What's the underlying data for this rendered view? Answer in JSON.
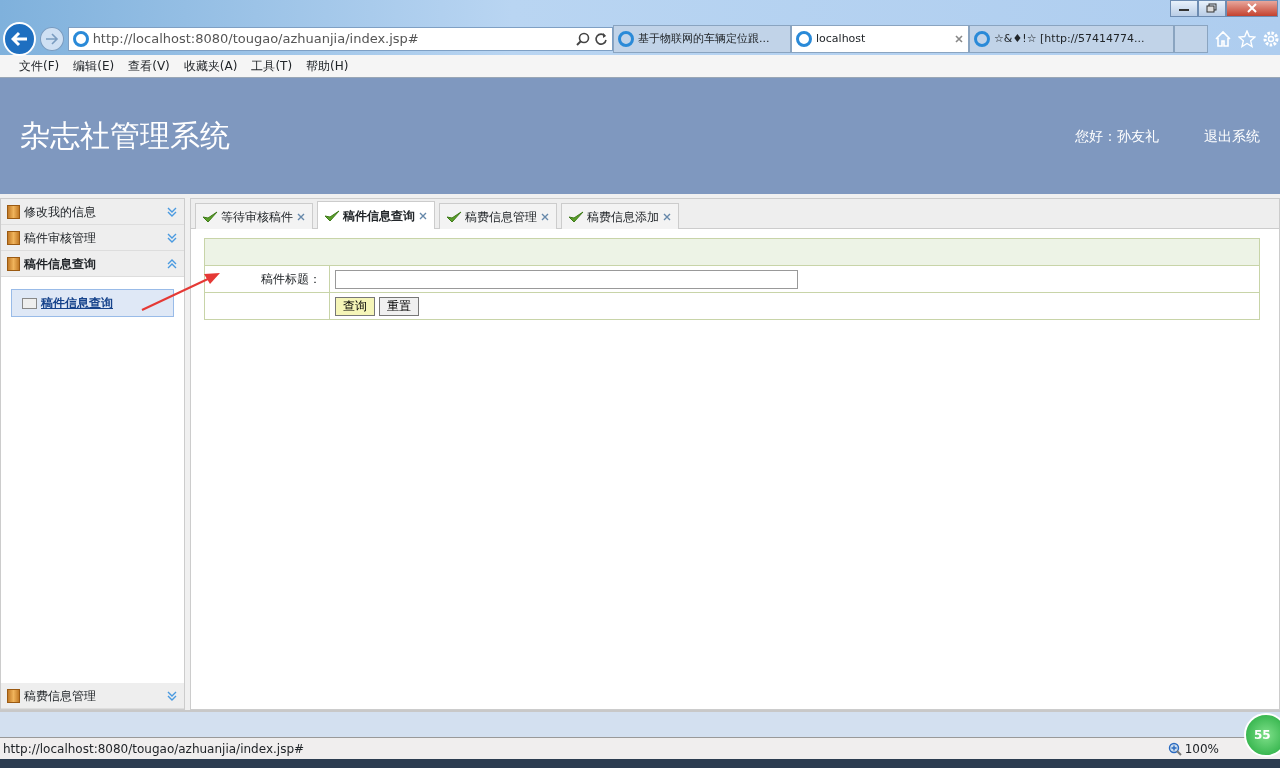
{
  "browser": {
    "address": "http://localhost:8080/tougao/azhuanjia/index.jsp#",
    "tabs": [
      {
        "title": "基于物联网的车辆定位跟...",
        "selected": false
      },
      {
        "title": "localhost",
        "selected": true
      },
      {
        "title": "☆&♦!☆ [http://57414774...",
        "selected": false
      }
    ],
    "menu": [
      "文件(F)",
      "编辑(E)",
      "查看(V)",
      "收藏夹(A)",
      "工具(T)",
      "帮助(H)"
    ]
  },
  "header": {
    "title": "杂志社管理系统",
    "greeting": "您好：孙友礼",
    "logout": "退出系统"
  },
  "sidebar": {
    "sections": [
      {
        "label": "修改我的信息",
        "expanded": false
      },
      {
        "label": "稿件审核管理",
        "expanded": false
      },
      {
        "label": "稿件信息查询",
        "expanded": true,
        "children": [
          {
            "label": "稿件信息查询",
            "selected": true
          }
        ]
      },
      {
        "label": "稿费信息管理",
        "expanded": false
      }
    ]
  },
  "page_tabs": [
    {
      "label": "等待审核稿件",
      "selected": false
    },
    {
      "label": "稿件信息查询",
      "selected": true
    },
    {
      "label": "稿费信息管理",
      "selected": false
    },
    {
      "label": "稿费信息添加",
      "selected": false
    }
  ],
  "form": {
    "field_label": "稿件标题：",
    "buttons": [
      {
        "label": "查询",
        "kind": "primary"
      },
      {
        "label": "重置",
        "kind": "default"
      }
    ]
  },
  "status_bar": {
    "url": "http://localhost:8080/tougao/azhuanjia/index.jsp#",
    "zoom": "100%"
  },
  "badge": "55"
}
